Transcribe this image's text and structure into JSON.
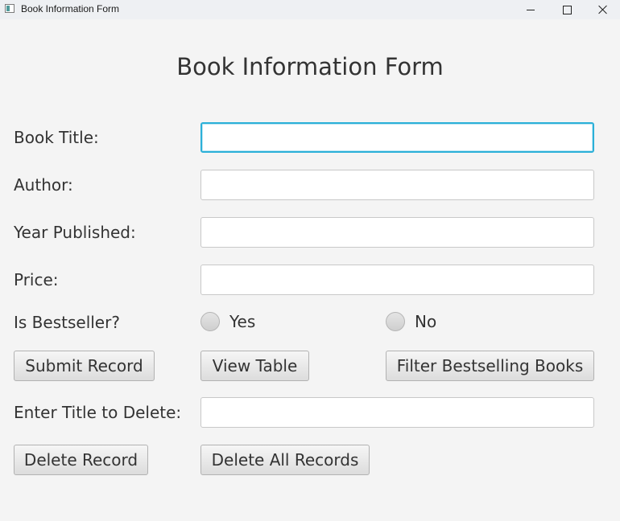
{
  "window": {
    "title": "Book Information Form",
    "controls": {
      "minimize": "minimize",
      "maximize": "maximize",
      "close": "close"
    }
  },
  "form": {
    "heading": "Book Information Form",
    "fields": {
      "title": {
        "label": "Book Title:",
        "value": ""
      },
      "author": {
        "label": "Author:",
        "value": ""
      },
      "year": {
        "label": "Year Published:",
        "value": ""
      },
      "price": {
        "label": "Price:",
        "value": ""
      }
    },
    "bestseller": {
      "label": "Is Bestseller?",
      "options": {
        "yes": "Yes",
        "no": "No"
      }
    },
    "buttons": {
      "submit": "Submit Record",
      "view": "View Table",
      "filter": "Filter Bestselling Books",
      "delete": "Delete Record",
      "delete_all": "Delete All Records"
    },
    "delete_field": {
      "label": "Enter Title to Delete:",
      "value": ""
    }
  }
}
